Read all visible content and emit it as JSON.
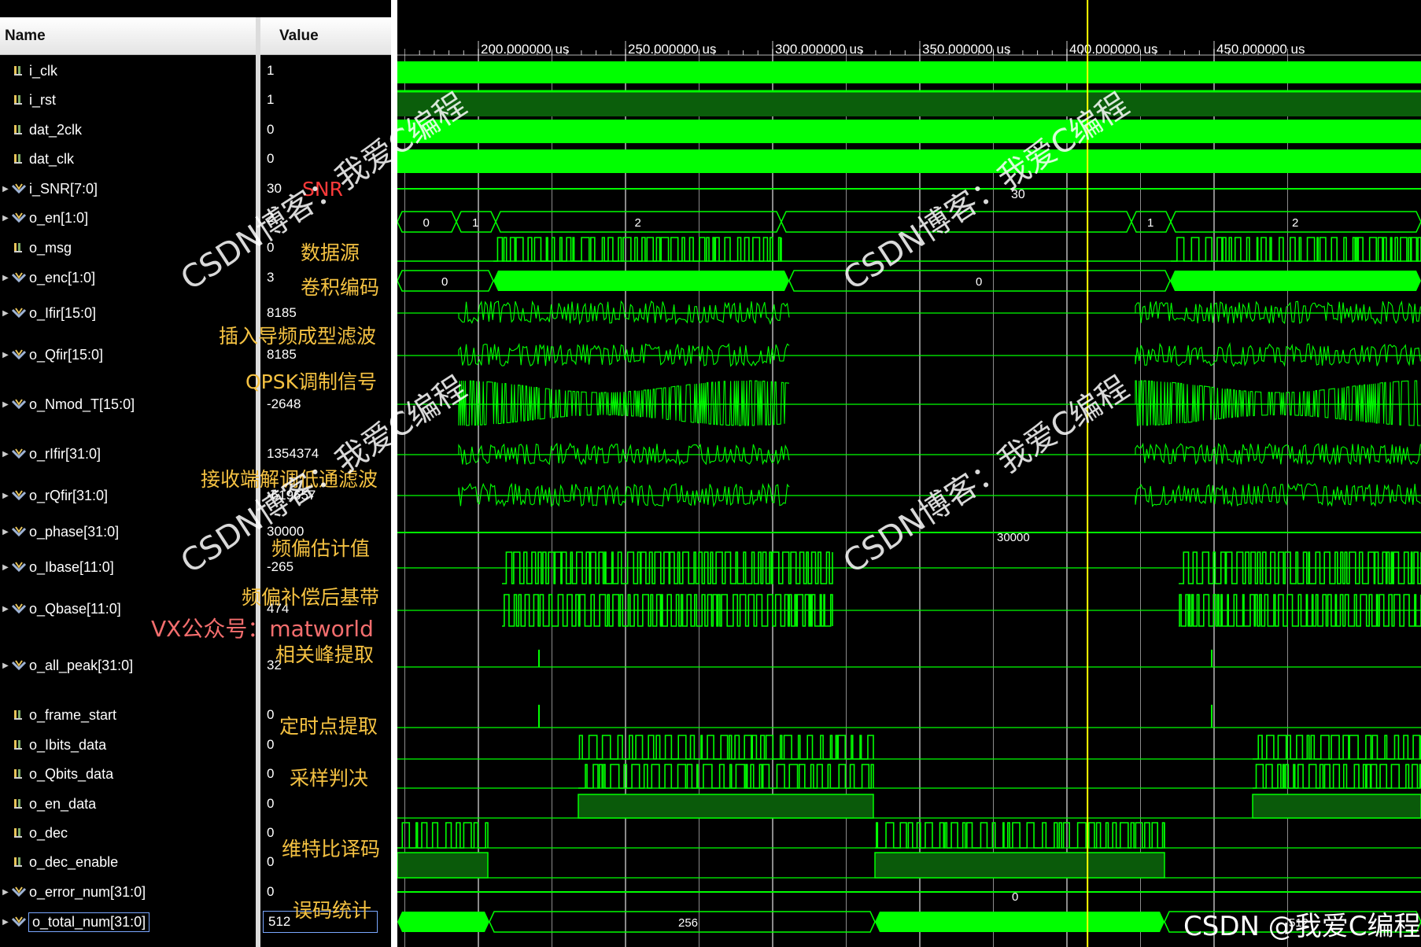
{
  "columns": {
    "name": "Name",
    "value": "Value"
  },
  "timeline": {
    "ticks": [
      {
        "t": 200,
        "label": "200.000000 us"
      },
      {
        "t": 250,
        "label": "250.000000 us"
      },
      {
        "t": 300,
        "label": "300.000000 us"
      },
      {
        "t": 350,
        "label": "350.000000 us"
      },
      {
        "t": 400,
        "label": "400.000000 us"
      },
      {
        "t": 450,
        "label": "450.000000 us"
      }
    ],
    "cursor_t": 407
  },
  "signals": [
    {
      "name": "i_clk",
      "value": "1",
      "icon": "bit-icon",
      "expandable": false
    },
    {
      "name": "i_rst",
      "value": "1",
      "icon": "bit-icon",
      "expandable": false
    },
    {
      "name": "dat_2clk",
      "value": "0",
      "icon": "bit-icon",
      "expandable": false
    },
    {
      "name": "dat_clk",
      "value": "0",
      "icon": "bit-icon",
      "expandable": false
    },
    {
      "name": "i_SNR[7:0]",
      "value": "30",
      "icon": "bus-icon",
      "expandable": true
    },
    {
      "name": "o_en[1:0]",
      "value": "2",
      "icon": "bus-icon",
      "expandable": true
    },
    {
      "name": "o_msg",
      "value": "0",
      "icon": "bit-icon",
      "expandable": false
    },
    {
      "name": "o_enc[1:0]",
      "value": "3",
      "icon": "bus-icon",
      "expandable": true
    },
    {
      "name": "o_Ifir[15:0]",
      "value": "8185",
      "icon": "bus-icon",
      "expandable": true
    },
    {
      "name": "o_Qfir[15:0]",
      "value": "8185",
      "icon": "bus-icon",
      "expandable": true
    },
    {
      "name": "o_Nmod_T[15:0]",
      "value": "-2648",
      "icon": "bus-icon",
      "expandable": true
    },
    {
      "name": "o_rIfir[31:0]",
      "value": "1354374",
      "icon": "bus-icon",
      "expandable": true
    },
    {
      "name": "o_rQfir[31:0]",
      "value": "-619657",
      "icon": "bus-icon",
      "expandable": true
    },
    {
      "name": "o_phase[31:0]",
      "value": "30000",
      "icon": "bus-icon",
      "expandable": true
    },
    {
      "name": "o_Ibase[11:0]",
      "value": "-265",
      "icon": "bus-icon",
      "expandable": true
    },
    {
      "name": "o_Qbase[11:0]",
      "value": "474",
      "icon": "bus-icon",
      "expandable": true
    },
    {
      "name": "o_all_peak[31:0]",
      "value": "32",
      "icon": "bus-icon",
      "expandable": true
    },
    {
      "name": "o_frame_start",
      "value": "0",
      "icon": "bit-icon",
      "expandable": false
    },
    {
      "name": "o_Ibits_data",
      "value": "0",
      "icon": "bit-icon",
      "expandable": false
    },
    {
      "name": "o_Qbits_data",
      "value": "0",
      "icon": "bit-icon",
      "expandable": false
    },
    {
      "name": "o_en_data",
      "value": "0",
      "icon": "bit-icon",
      "expandable": false
    },
    {
      "name": "o_dec",
      "value": "0",
      "icon": "bit-icon",
      "expandable": false
    },
    {
      "name": "o_dec_enable",
      "value": "0",
      "icon": "bit-icon",
      "expandable": false
    },
    {
      "name": "o_error_num[31:0]",
      "value": "0",
      "icon": "bus-icon",
      "expandable": true
    },
    {
      "name": "o_total_num[31:0]",
      "value": "512",
      "icon": "bus-icon",
      "expandable": true,
      "selected": true
    }
  ],
  "wave_labels": {
    "snr": "30",
    "en": [
      "0",
      "1",
      "2",
      "1",
      "2"
    ],
    "enc": [
      "0",
      "0"
    ],
    "phase": "30000",
    "error": "0",
    "total": [
      "256",
      "512"
    ]
  },
  "annotations": {
    "snr": "SNR",
    "msg": "数据源",
    "enc": "卷积编码",
    "fir": "插入导频成型滤波",
    "qpsk": "QPSK调制信号",
    "rx": "接收端解调低通滤波",
    "phase": "频偏估计值",
    "base": "频偏补偿后基带",
    "vx": "VX公众号：matworld",
    "peak": "相关峰提取",
    "timing": "定时点提取",
    "sample": "采样判决",
    "viterbi": "维特比译码",
    "error": "误码统计"
  },
  "watermarks": [
    "CSDN博客：我爱C编程",
    "CSDN博客：我爱C编程",
    "CSDN博客：我爱C编程",
    "CSDN博客：我爱C编程"
  ],
  "footer": "CSDN @我爱C编程",
  "colors": {
    "wave": "#00ff00",
    "wave_dim": "#2b7a2b",
    "fill": "#0a5a0a",
    "cursor": "#ffff00",
    "grid": "#ffffff"
  }
}
